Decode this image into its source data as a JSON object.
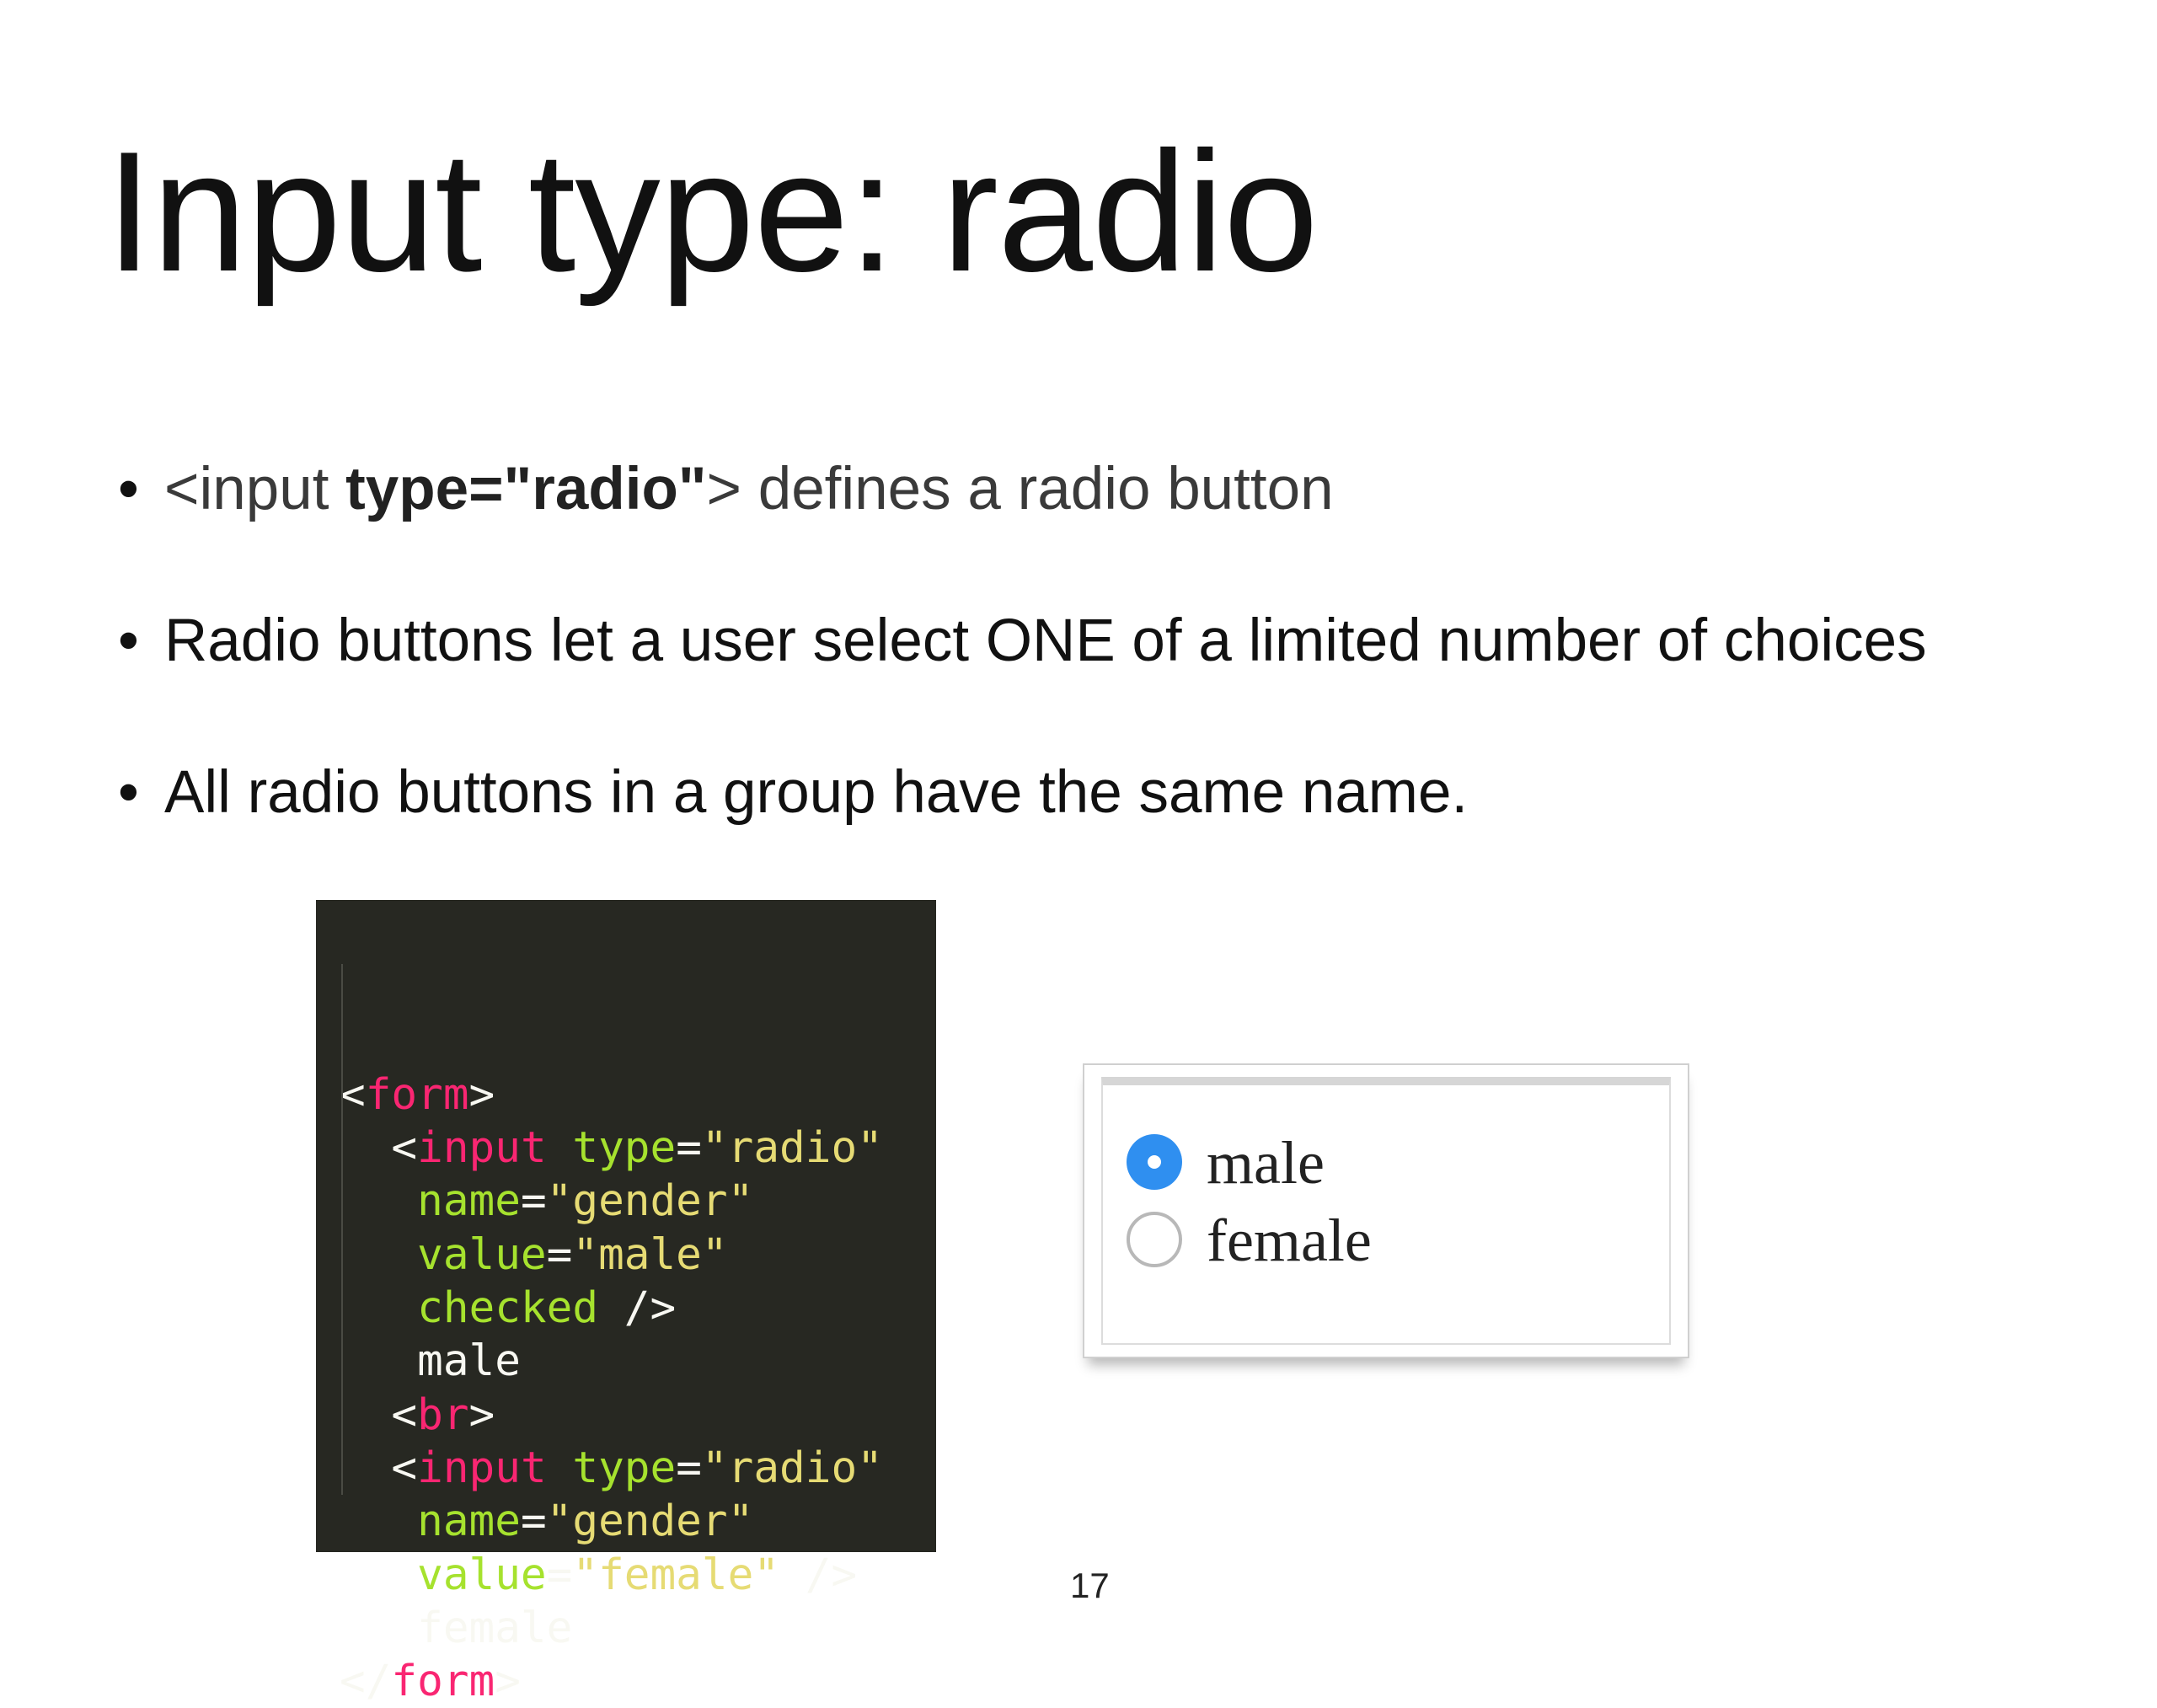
{
  "slide": {
    "title": "Input type: radio",
    "bullets": [
      {
        "prefix": "<input ",
        "bold": "type=\"radio\"",
        "suffix": "> defines a radio button"
      },
      {
        "text": "Radio buttons let a user select ONE of a limited number of choices"
      },
      {
        "text": "All radio buttons in a group have the same name."
      }
    ],
    "bullet_char": "•",
    "page_number": "17"
  },
  "code": {
    "lines": [
      [
        {
          "c": "p",
          "t": "<"
        },
        {
          "c": "t",
          "t": "form"
        },
        {
          "c": "p",
          "t": ">"
        }
      ],
      [
        {
          "c": "p",
          "t": "  <"
        },
        {
          "c": "t",
          "t": "input"
        },
        {
          "c": "p",
          "t": " "
        },
        {
          "c": "a",
          "t": "type"
        },
        {
          "c": "p",
          "t": "="
        },
        {
          "c": "s",
          "t": "\"radio\""
        }
      ],
      [
        {
          "c": "a",
          "t": "   name"
        },
        {
          "c": "p",
          "t": "="
        },
        {
          "c": "s",
          "t": "\"gender\""
        }
      ],
      [
        {
          "c": "a",
          "t": "   value"
        },
        {
          "c": "p",
          "t": "="
        },
        {
          "c": "s",
          "t": "\"male\""
        }
      ],
      [
        {
          "c": "a",
          "t": "   checked"
        },
        {
          "c": "p",
          "t": " />"
        }
      ],
      [
        {
          "c": "p",
          "t": "   male"
        }
      ],
      [
        {
          "c": "p",
          "t": "  <"
        },
        {
          "c": "t",
          "t": "br"
        },
        {
          "c": "p",
          "t": ">"
        }
      ],
      [
        {
          "c": "p",
          "t": "  <"
        },
        {
          "c": "t",
          "t": "input"
        },
        {
          "c": "p",
          "t": " "
        },
        {
          "c": "a",
          "t": "type"
        },
        {
          "c": "p",
          "t": "="
        },
        {
          "c": "s",
          "t": "\"radio\""
        }
      ],
      [
        {
          "c": "a",
          "t": "   name"
        },
        {
          "c": "p",
          "t": "="
        },
        {
          "c": "s",
          "t": "\"gender\""
        }
      ],
      [
        {
          "c": "a",
          "t": "   value"
        },
        {
          "c": "p",
          "t": "="
        },
        {
          "c": "s",
          "t": "\"female\""
        },
        {
          "c": "p",
          "t": " />"
        }
      ],
      [
        {
          "c": "p",
          "t": "   female"
        }
      ],
      [
        {
          "c": "p",
          "t": "</"
        },
        {
          "c": "t",
          "t": "form"
        },
        {
          "c": "p",
          "t": ">"
        }
      ]
    ],
    "colors": {
      "background": "#272822",
      "tag": "#f92672",
      "attribute": "#a6e22e",
      "string": "#e6db74",
      "plain": "#f8f8f2"
    }
  },
  "preview": {
    "options": [
      {
        "label": "male",
        "checked": true
      },
      {
        "label": "female",
        "checked": false
      }
    ],
    "accent": "#2f8ff0"
  }
}
